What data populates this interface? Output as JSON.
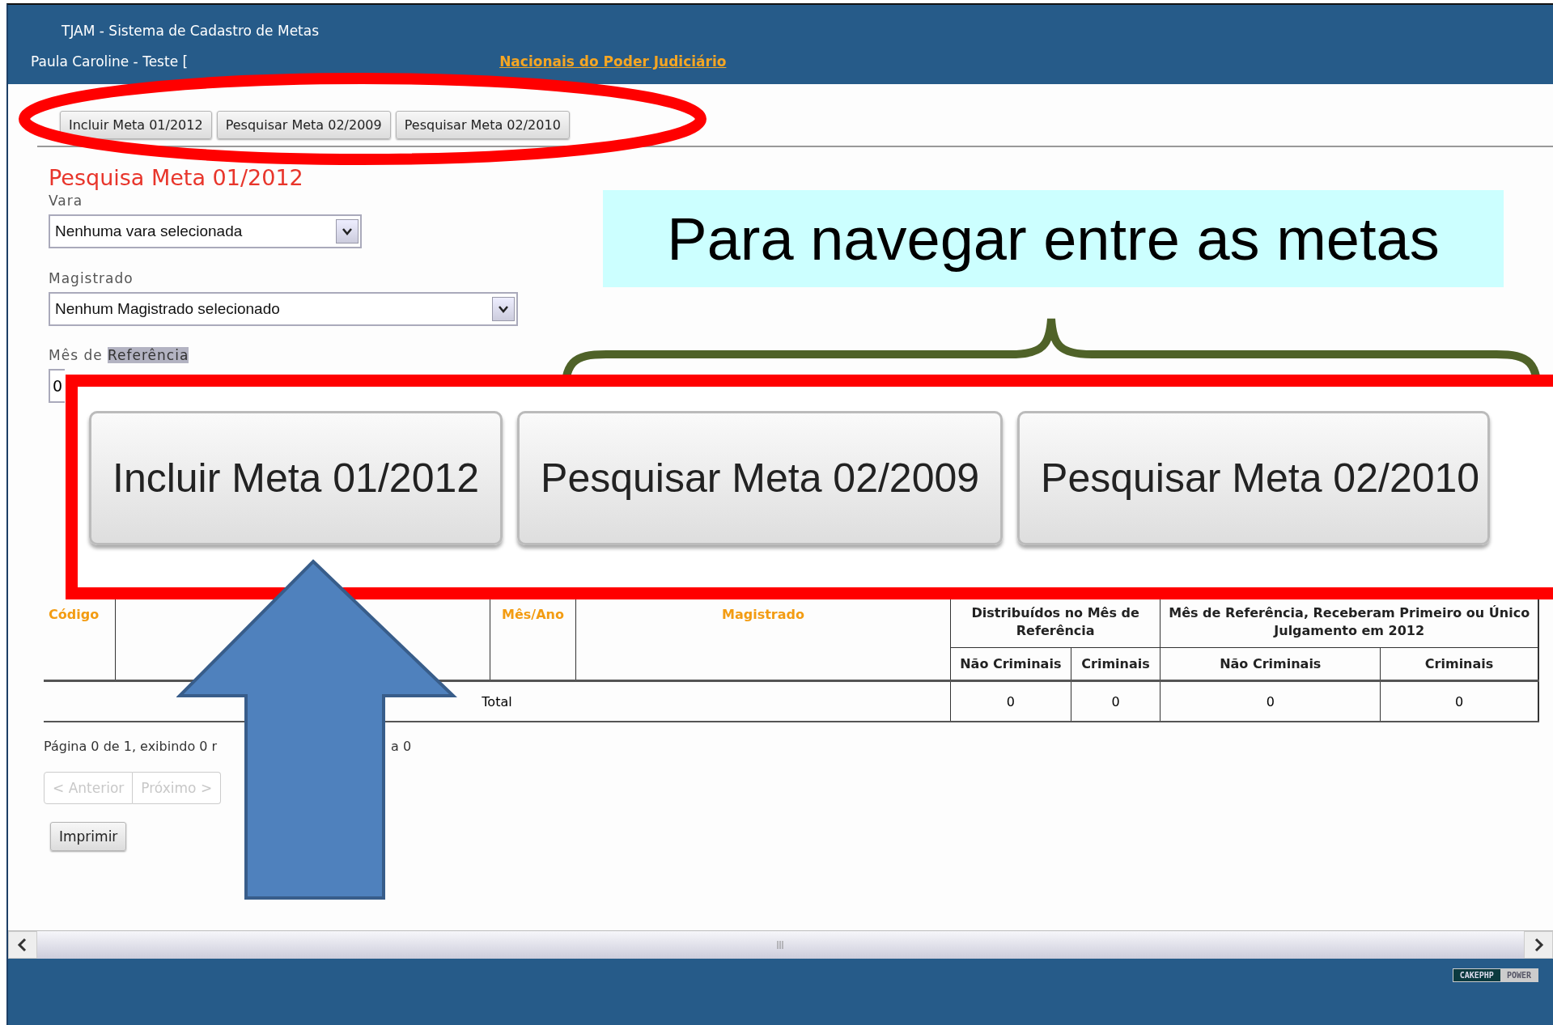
{
  "header": {
    "title": "TJAM - Sistema de Cadastro de Metas",
    "user": "Paula Caroline - Teste [",
    "link": "Nacionais do Poder Judiciário"
  },
  "nav_buttons": [
    {
      "label": "Incluir Meta 01/2012"
    },
    {
      "label": "Pesquisar Meta 02/2009"
    },
    {
      "label": "Pesquisar Meta 02/2010"
    }
  ],
  "page_title": "Pesquisa Meta 01/2012",
  "form": {
    "fields": [
      {
        "kind": "select",
        "label": "Vara",
        "value": "Nenhuma vara selecionada"
      },
      {
        "kind": "select",
        "label": "Magistrado",
        "value": "Nenhum Magistrado selecionado"
      },
      {
        "kind": "text",
        "label": "Mês de",
        "highlighted_label": "Referência",
        "value": "0"
      }
    ]
  },
  "table": {
    "columns": [
      {
        "kind": "sort",
        "label": "Código"
      },
      {
        "kind": "blank"
      },
      {
        "kind": "sort",
        "label": "Mês/Ano"
      },
      {
        "kind": "sort",
        "label": "Magistrado"
      },
      {
        "kind": "group",
        "label": "Distribuídos no Mês de Referência",
        "subcolumns": [
          "Não Criminais",
          "Criminais"
        ]
      },
      {
        "kind": "group",
        "label": "Mês de Referência, Receberam Primeiro ou Único Julgamento em 2012",
        "subcolumns": [
          "Não Criminais",
          "Criminais"
        ]
      }
    ],
    "total_row": {
      "label": "Total",
      "values": [
        "0",
        "0",
        "0",
        "0"
      ]
    }
  },
  "pagination": {
    "summary_start": "Página 0 de 1, exibindo 0 r",
    "summary_end": "a 0",
    "buttons": [
      {
        "label": "< Anterior",
        "disabled": true
      },
      {
        "label": "Próximo >",
        "disabled": true
      }
    ]
  },
  "print_button": "Imprimir",
  "footer": {
    "badge": [
      "CAKEPHP",
      "POWER"
    ]
  },
  "annotations": {
    "callout": "Para navegar entre as metas",
    "zoomed_buttons": [
      "Incluir Meta 01/2012",
      "Pesquisar Meta 02/2009",
      "Pesquisar Meta 02/2010"
    ]
  }
}
